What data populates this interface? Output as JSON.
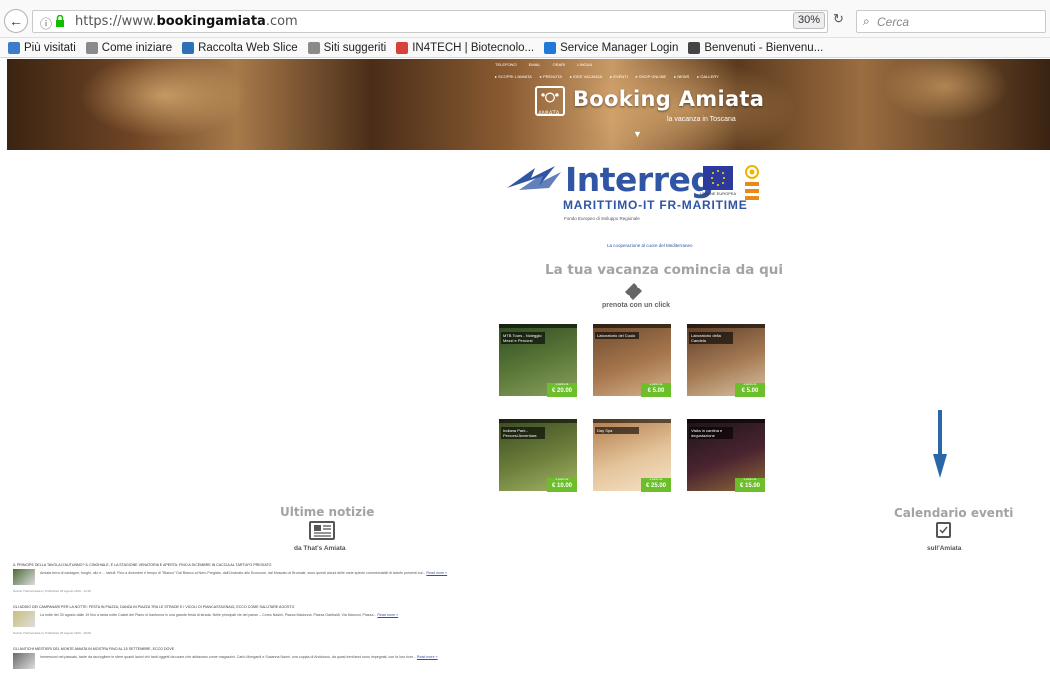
{
  "browser": {
    "url_prefix": "https://www.",
    "url_domain": "bookingamiata",
    "url_suffix": ".com",
    "zoom": "30%",
    "search_placeholder": "Cerca",
    "bookmarks": [
      {
        "label": "Più visitati",
        "icon_color": "#3d7cc9"
      },
      {
        "label": "Come iniziare",
        "icon_color": "#8a8a8a"
      },
      {
        "label": "Raccolta Web Slice",
        "icon_color": "#2f6fb8"
      },
      {
        "label": "Siti suggeriti",
        "icon_color": "#8a8a8a"
      },
      {
        "label": "IN4TECH | Biotecnolo...",
        "icon_color": "#d8403b"
      },
      {
        "label": "Service Manager Login",
        "icon_color": "#1e7ad6"
      },
      {
        "label": "Benvenuti - Bienvenu...",
        "icon_color": "#444444"
      }
    ]
  },
  "hero": {
    "top_links": [
      "TELEFONO",
      "EMAIL",
      "ORARI",
      "LINGUA"
    ],
    "nav": [
      "SCOPRI L'AMIATA",
      "PRENOTA",
      "IDEE VACANZA",
      "EVENTI",
      "SHOP ONLINE",
      "NEWS",
      "GALLERY"
    ],
    "title": "Booking Amiata",
    "logo_label": "AMIATA",
    "subtitle": "la vacanza in Toscana"
  },
  "interreg": {
    "word": "Interreg",
    "program": "MARITTIMO-IT FR-MARITIME",
    "fondo": "Fondo Europeo di Sviluppo Regionale",
    "eu_label": "UNIONE EUROPEA",
    "cooperation": "La cooperazione al cuore del Mediterraneo"
  },
  "main": {
    "tagline": "La tua vacanza comincia da qui",
    "cta": "prenota con un click"
  },
  "products": [
    {
      "name": "MTB Tours - Noleggio Mezzi e Percorsi",
      "price": "€ 20.00",
      "from": "a partire da"
    },
    {
      "name": "Laboratorio del Cuoio",
      "price": "€ 5.00",
      "from": "a partire da"
    },
    {
      "name": "Laboratorio della Candela",
      "price": "€ 5.00",
      "from": "a partire da"
    },
    {
      "name": "Indiana Park - Percorsi Avventura",
      "price": "€ 10.00",
      "from": "a partire da"
    },
    {
      "name": "Day Spa",
      "price": "€ 25.00",
      "from": "a partire da"
    },
    {
      "name": "Visita in cantina e degustazione",
      "price": "€ 15.00",
      "from": "a partire da"
    }
  ],
  "news": {
    "title": "Ultime notizie",
    "source": "da That's Amiata",
    "articles": [
      {
        "headline": "IL PRINCIPE DELLA TAVOLA D'AUTUNNO? IL CINGHIALE, E LA STAGIONE VENATORIA E APERTA: FINO A DICEMBRE IN CACCIA AL TARTUFO PREGIATO",
        "excerpt": "Amiata terra di castagne, funghi, olio e ... tartufi. Fino a dicembre è tempo di \"Bianco\" Dal Bianco al Nero Pregiato, dall'Uncinato allo Scorzone, dal Moscato al Brumale, sono questi alcuni delle varie specie commerciabili di tartufo presenti sul...",
        "more": "Read more »",
        "meta": "Notizie That'sAmiata.it | Pubblicato 26 Agosto 2019 - 12:30",
        "thumb_color": "#4d6b3a"
      },
      {
        "headline": "GLI ADDIO DEI CAMPANARI PER LA NOTTE: FESTA IN PIAZZA, DANZA IN PIAZZA TRA LE STRADE E I VICOLI DI PIANCASTAGNAIO, ECCO COME SALUTARE AGOSTO",
        "excerpt": "La notte del 30 agosto dalle 19 fino a tarda notte Castel del Piano si trasforma in una grande festa di strada. Nelle principali vie del paese – Corso Nasini, Piazza Madonna, Piazza Garibaldi, Via Marconi, Piazza...",
        "more": "Read more »",
        "meta": "Notizie That'sAmiata.it | Pubblicato 25 Agosto 2019 - 18:00",
        "thumb_color": "#c9c07a"
      },
      {
        "headline": "GLI ANTICHI MESTIERI DEL MONTE AMIATA IN MOSTRA FINO AL 15 SETTEMBRE, ECCO DOVE",
        "excerpt": "Immersioni nel passato, tante da raccogliere le sfere quanti lavori vivi tanti oggetti da usare che abitavano come magazzini. Carlo Mongardi e Susanna Nanni, una coppia di Arcidosso, da quasi trent'anni sono impegnati, con la loro ricer...",
        "more": "Read more »",
        "meta": "",
        "thumb_color": "#6b6b6b"
      }
    ]
  },
  "calendar": {
    "title": "Calendario eventi",
    "subtitle": "sull'Amiata"
  },
  "colors": {
    "accent_blue": "#2f55a4",
    "price_green": "#6cbf2a",
    "arrow_blue": "#2a67a8",
    "heading_gray": "#a3a3a3"
  }
}
